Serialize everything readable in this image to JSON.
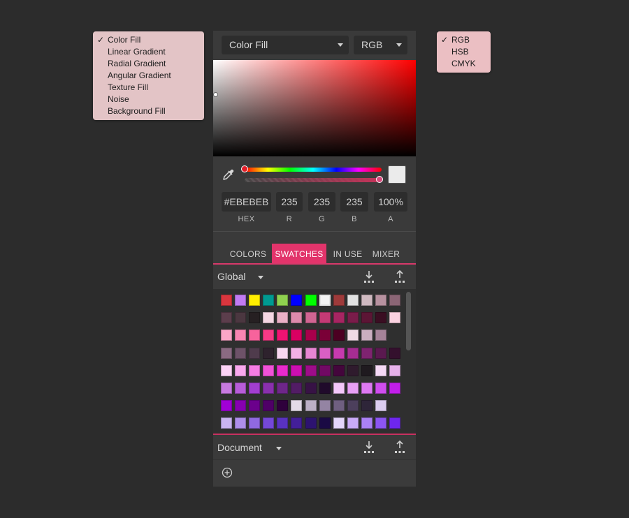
{
  "fill_menu": {
    "items": [
      {
        "label": "Color Fill",
        "checked": true
      },
      {
        "label": "Linear Gradient",
        "checked": false
      },
      {
        "label": "Radial Gradient",
        "checked": false
      },
      {
        "label": "Angular Gradient",
        "checked": false
      },
      {
        "label": "Texture Fill",
        "checked": false
      },
      {
        "label": "Noise",
        "checked": false
      },
      {
        "label": "Background Fill",
        "checked": false
      }
    ],
    "check_glyph": "✓"
  },
  "model_menu": {
    "items": [
      {
        "label": "RGB",
        "checked": true
      },
      {
        "label": "HSB",
        "checked": false
      },
      {
        "label": "CMYK",
        "checked": false
      }
    ]
  },
  "panel": {
    "fill_type": "Color Fill",
    "color_model": "RGB",
    "hue_color": "#ff0000",
    "current_color": "#EBEBEB",
    "fields": {
      "hex": {
        "value": "#EBEBEB",
        "label": "HEX"
      },
      "r": {
        "value": "235",
        "label": "R"
      },
      "g": {
        "value": "235",
        "label": "G"
      },
      "b": {
        "value": "235",
        "label": "B"
      },
      "a": {
        "value": "100%",
        "label": "A"
      }
    },
    "tabs": [
      {
        "label": "COLORS",
        "active": false
      },
      {
        "label": "SWATCHES",
        "active": true
      },
      {
        "label": "IN USE",
        "active": false
      },
      {
        "label": "MIXER",
        "active": false
      }
    ],
    "global_group": "Global",
    "document_group": "Document",
    "accent": "#e2346b"
  },
  "swatches": [
    [
      "#d9363e",
      "#c17bf3",
      "#ffee00",
      "#009a91",
      "#8fd14f",
      "#0000ff",
      "#00ff00",
      "#f4f4f4",
      "#9e3a3a",
      "#e2e2e2",
      "#cfb9c0",
      "#b7919f",
      "#8b6575"
    ],
    [
      "#5c3e4c",
      "#4b3740",
      "#262022",
      "#f5d7e3",
      "#eab0c6",
      "#de8aab",
      "#d16592",
      "#c43a75",
      "#a72562",
      "#7a1c4a",
      "#5c1535",
      "#3a0e22",
      "#fbd2e1"
    ],
    [
      "#fba6c7",
      "#f985b2",
      "#f7639c",
      "#f53a86",
      "#f01372",
      "#d90062",
      "#a8004b",
      "#7a0037",
      "#4c0022",
      "#efdbe4",
      "#cbaec0",
      "#a58298"
    ],
    [
      "#8a6a82",
      "#6d5268",
      "#4f3b4c",
      "#2e222d",
      "#f9d7f1",
      "#f3b0e5",
      "#e886d3",
      "#d95fc3",
      "#c63aae",
      "#a62d92",
      "#7f2370",
      "#5a194f",
      "#34102d"
    ],
    [
      "#fcd2f6",
      "#f9a8ee",
      "#f57de3",
      "#f052d8",
      "#e82acd",
      "#cc0fb1",
      "#9e0c89",
      "#710964",
      "#44063c",
      "#2f1b2d",
      "#1f1a1f",
      "#f5d9f6",
      "#e6b1ea"
    ],
    [
      "#c77ae0",
      "#b75cd9",
      "#a23ed0",
      "#8a30ad",
      "#6e2689",
      "#521c65",
      "#371245",
      "#200a2b",
      "#f3c7f9",
      "#e8a0f5",
      "#de79f2",
      "#d04dee",
      "#c11eea"
    ],
    [
      "#a000d6",
      "#8600b0",
      "#6b008c",
      "#4f0067",
      "#2f003c",
      "#e3dbe8",
      "#bcb0c6",
      "#9484a3",
      "#6f5f80",
      "#4c3f5c",
      "#2e2539",
      "#dccdf0"
    ],
    [
      "#c9b3f0",
      "#ae8eea",
      "#9069e1",
      "#7548d8",
      "#5932c0",
      "#431f99",
      "#2d1370",
      "#1a0a44",
      "#e4d6fb",
      "#c9abf8",
      "#ab81f5",
      "#8c55f2",
      "#6e26ef"
    ]
  ]
}
